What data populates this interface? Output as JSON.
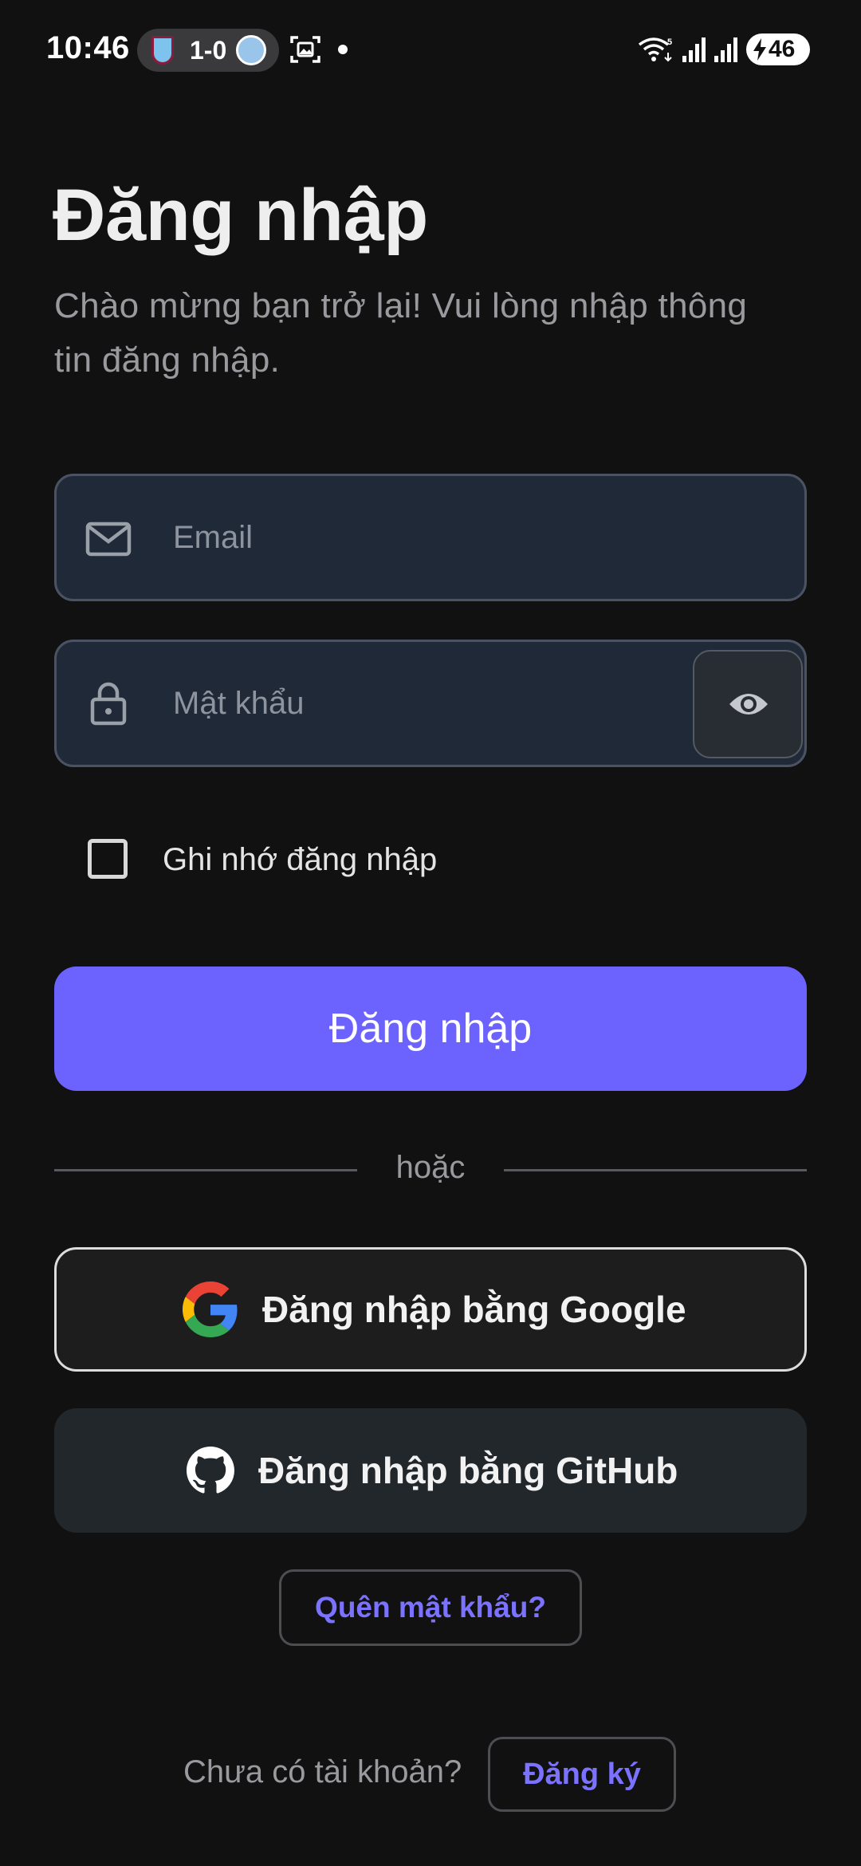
{
  "status_bar": {
    "time": "10:46",
    "score": "1-0",
    "battery": "46"
  },
  "header": {
    "title": "Đăng nhập",
    "subtitle": "Chào mừng bạn trở lại! Vui lòng nhập thông tin đăng nhập."
  },
  "form": {
    "email_placeholder": "Email",
    "email_value": "",
    "password_placeholder": "Mật khẩu",
    "password_value": "",
    "remember_label": "Ghi nhớ đăng nhập",
    "remember_checked": false,
    "submit_label": "Đăng nhập"
  },
  "divider": {
    "text": "hoặc"
  },
  "social": {
    "google_label": "Đăng nhập bằng Google",
    "github_label": "Đăng nhập bằng GitHub"
  },
  "links": {
    "forgot_label": "Quên mật khẩu?",
    "no_account_text": "Chưa có tài khoản?",
    "register_label": "Đăng ký"
  },
  "icons": {
    "email": "mail-icon",
    "password": "lock-icon",
    "toggle_visibility": "eye-icon",
    "google": "google-logo-icon",
    "github": "github-logo-icon"
  },
  "colors": {
    "background": "#111112",
    "accent": "#6c63ff",
    "link": "#7b72ff",
    "field_bg": "#1f2938",
    "github_button_bg": "#22272c"
  }
}
